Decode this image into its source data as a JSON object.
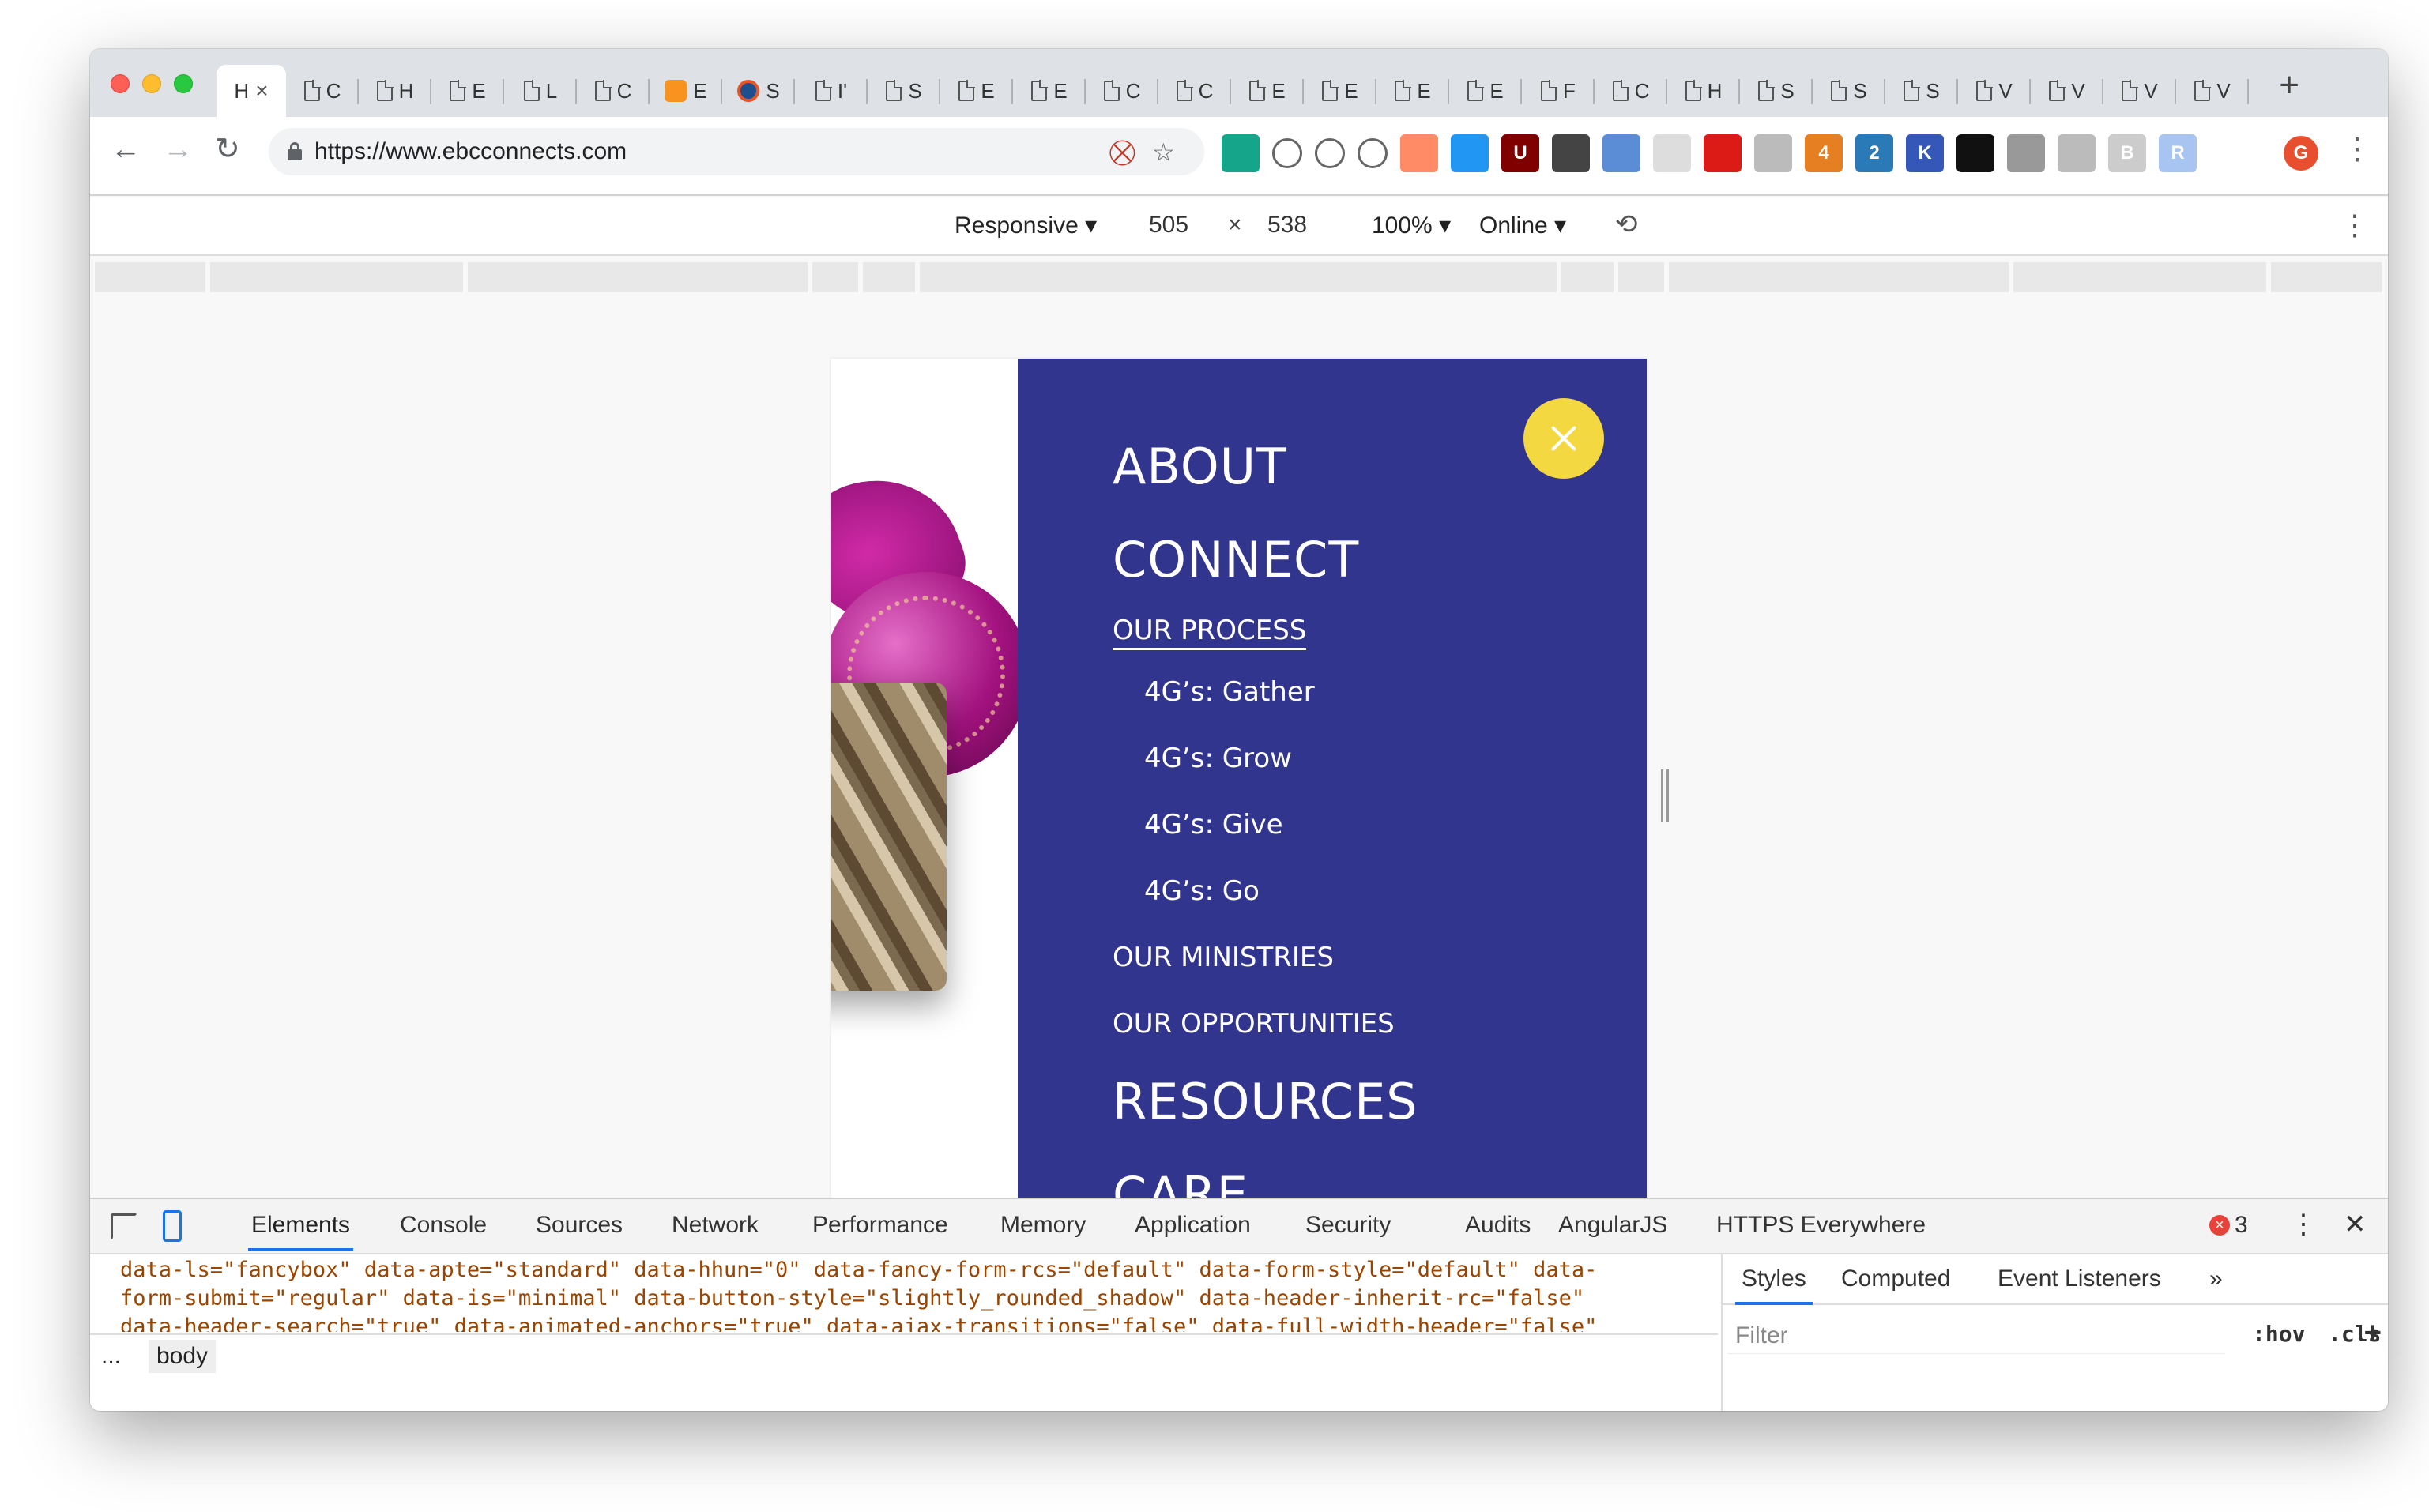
{
  "browser": {
    "active_tab_title": "H",
    "tabs": [
      {
        "label": "C",
        "icon": "page-icon"
      },
      {
        "label": "H",
        "icon": "page-icon"
      },
      {
        "label": "E",
        "icon": "page-icon"
      },
      {
        "label": "L",
        "icon": "page-icon"
      },
      {
        "label": "C",
        "icon": "page-icon"
      },
      {
        "label": "E",
        "icon": "orange-favicon"
      },
      {
        "label": "S",
        "icon": "blue-favicon"
      },
      {
        "label": "I'",
        "icon": "page-icon"
      },
      {
        "label": "S",
        "icon": "page-icon"
      },
      {
        "label": "E",
        "icon": "page-icon"
      },
      {
        "label": "E",
        "icon": "page-icon"
      },
      {
        "label": "C",
        "icon": "page-icon"
      },
      {
        "label": "C",
        "icon": "page-icon"
      },
      {
        "label": "E",
        "icon": "page-icon"
      },
      {
        "label": "E",
        "icon": "page-icon"
      },
      {
        "label": "E",
        "icon": "page-icon"
      },
      {
        "label": "E",
        "icon": "page-icon"
      },
      {
        "label": "F",
        "icon": "page-icon"
      },
      {
        "label": "C",
        "icon": "page-icon"
      },
      {
        "label": "H",
        "icon": "page-icon"
      },
      {
        "label": "S",
        "icon": "page-icon"
      },
      {
        "label": "S",
        "icon": "page-icon"
      },
      {
        "label": "S",
        "icon": "page-icon"
      },
      {
        "label": "V",
        "icon": "page-icon"
      },
      {
        "label": "V",
        "icon": "page-icon"
      },
      {
        "label": "V",
        "icon": "page-icon"
      },
      {
        "label": "V",
        "icon": "page-icon"
      }
    ],
    "url": "https://www.ebcconnects.com",
    "profile_initial": "G",
    "extensions": [
      {
        "icon": "extension-green-icon",
        "color": "#15a58a",
        "text": ""
      },
      {
        "icon": "cast-icon",
        "color": "#ffffff",
        "text": ""
      },
      {
        "icon": "wordpress-icon",
        "color": "#ffffff",
        "text": ""
      },
      {
        "icon": "gear-ext-icon",
        "color": "#ffffff",
        "text": ""
      },
      {
        "icon": "extension-orange-icon",
        "color": "#ff8a65",
        "text": ""
      },
      {
        "icon": "extension-blue-icon",
        "color": "#2196f3",
        "text": ""
      },
      {
        "icon": "ublock-icon",
        "color": "#800000",
        "text": "U"
      },
      {
        "icon": "pocket-icon",
        "color": "#444444",
        "text": ""
      },
      {
        "icon": "extension-circle-icon",
        "color": "#5b8dd6",
        "text": ""
      },
      {
        "icon": "extension-grid-icon",
        "color": "#dddddd",
        "text": ""
      },
      {
        "icon": "angular-icon",
        "color": "#dd1b16",
        "text": ""
      },
      {
        "icon": "extension-grey-icon",
        "color": "#bbbbbb",
        "text": ""
      },
      {
        "icon": "extension-badge-4-icon",
        "color": "#e67e22",
        "text": "4"
      },
      {
        "icon": "extension-badge-2-icon",
        "color": "#2a7ab8",
        "text": "2"
      },
      {
        "icon": "k-icon",
        "color": "#3557b7",
        "text": "K"
      },
      {
        "icon": "extension-black-icon",
        "color": "#111111",
        "text": ""
      },
      {
        "icon": "camera-icon",
        "color": "#999999",
        "text": ""
      },
      {
        "icon": "chat-icon",
        "color": "#bbbbbb",
        "text": ""
      },
      {
        "icon": "extension-b-icon",
        "color": "#cccccc",
        "text": "B"
      },
      {
        "icon": "extension-r-icon",
        "color": "#a8c4f0",
        "text": "R"
      }
    ]
  },
  "device_toolbar": {
    "device": "Responsive",
    "width": "505",
    "height": "538",
    "zoom": "100%",
    "network": "Online"
  },
  "site_menu": {
    "close_color": "#f3d841",
    "background_color": "#31358e",
    "items": {
      "about": "ABOUT",
      "connect": "CONNECT",
      "our_process": "OUR PROCESS",
      "gather": "4G’s: Gather",
      "grow": "4G’s: Grow",
      "give": "4G’s: Give",
      "go": "4G’s: Go",
      "ministries": "OUR MINISTRIES",
      "opportunities": "OUR OPPORTUNITIES",
      "resources": "RESOURCES",
      "care": "CARE"
    }
  },
  "devtools": {
    "tabs": [
      "Elements",
      "Console",
      "Sources",
      "Network",
      "Performance",
      "Memory",
      "Application",
      "Security",
      "Audits",
      "AngularJS",
      "HTTPS Everywhere"
    ],
    "active_tab": "Elements",
    "error_count": "3",
    "code_lines": [
      "data-ls=\"fancybox\" data-apte=\"standard\" data-hhun=\"0\" data-fancy-form-rcs=\"default\" data-form-style=\"default\" data-",
      "form-submit=\"regular\" data-is=\"minimal\" data-button-style=\"slightly_rounded_shadow\" data-header-inherit-rc=\"false\"",
      "data-header-search=\"true\" data-animated-anchors=\"true\" data-ajax-transitions=\"false\" data-full-width-header=\"false\""
    ],
    "breadcrumb_ellipsis": "...",
    "breadcrumb_node": "body",
    "styles_tabs": [
      "Styles",
      "Computed",
      "Event Listeners"
    ],
    "styles_more": "»",
    "filter_placeholder": "Filter",
    "hov_label": ":hov",
    "cls_label": ".cls",
    "add_label": "+"
  }
}
